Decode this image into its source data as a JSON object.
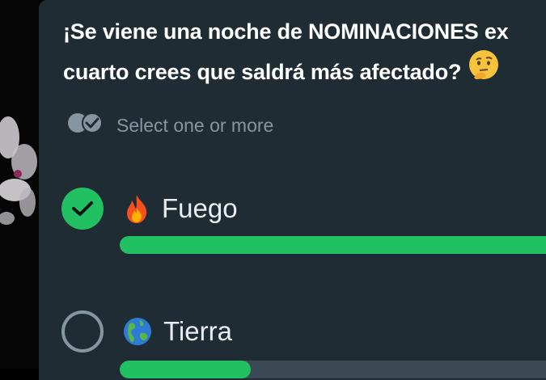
{
  "poll": {
    "question_line1": "¡Se viene una noche de NOMINACIONES ex",
    "question_line2": "cuarto crees que saldrá más afectado?",
    "question_emoji": "thinking-face-icon",
    "select_hint": "Select one or more",
    "options": [
      {
        "label": "Fuego",
        "emoji": "fire-icon",
        "selected": true,
        "progress_fraction": 1.0
      },
      {
        "label": "Tierra",
        "emoji": "globe-americas-icon",
        "selected": false,
        "progress_fraction": 0.29
      }
    ]
  },
  "colors": {
    "card_bg": "#202c33",
    "accent_green": "#21c063",
    "muted_gray": "#8696a0",
    "track": "#3b4a54"
  }
}
